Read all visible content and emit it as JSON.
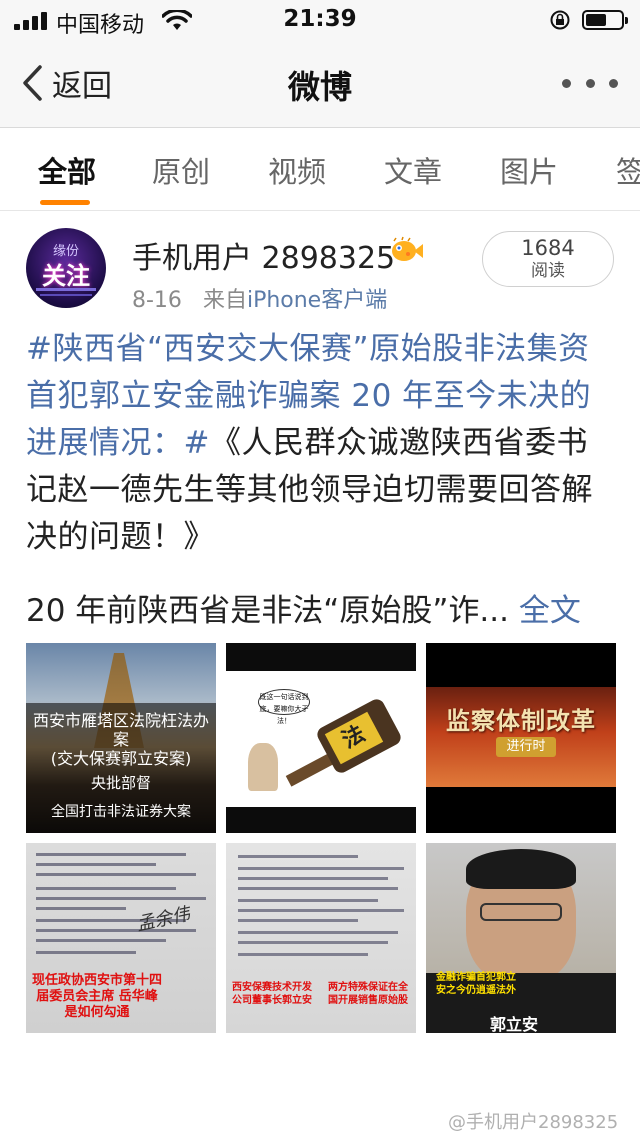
{
  "status_bar": {
    "carrier": "中国移动",
    "time": "21:39",
    "icons": [
      "signal-icon",
      "wifi-icon",
      "rotation-lock-icon",
      "battery-icon"
    ]
  },
  "nav": {
    "back_label": "返回",
    "title": "微博",
    "more_icon": "more-dots-icon"
  },
  "tabs": [
    {
      "label": "全部",
      "active": true
    },
    {
      "label": "原创",
      "active": false
    },
    {
      "label": "视频",
      "active": false
    },
    {
      "label": "文章",
      "active": false
    },
    {
      "label": "图片",
      "active": false
    },
    {
      "label": "签",
      "active": false
    }
  ],
  "accent_color": "#ff8200",
  "link_color": "#4a6ea8",
  "post": {
    "avatar_text": "关注",
    "avatar_top_text": "缘份",
    "username": "手机用户 2898325",
    "badge_icon": "pufferfish-badge-icon",
    "date": "8-16",
    "source_prefix": "来自",
    "source": "iPhone客户端",
    "reads_count": "1684",
    "reads_label": "阅读",
    "topic": "#陕西省“西安交大保赛”原始股非法集资首犯郭立安金融诈骗案 20 年至今未决的进展情况：#",
    "body_after_topic": "《人民群众诚邀陕西省委书记赵一德先生等其他领导迫切需要回答解决的问题！》",
    "excerpt": "20 年前陕西省是非法“原始股”诈...",
    "full_text_link": "全文",
    "images": {
      "img1": {
        "line1": "西安市雁塔区法院枉法办案",
        "line1b": "(交大保赛郭立安案)",
        "line2": "央批部督",
        "line3": "全国打击非法证券大案"
      },
      "img2": {
        "bubble": "既这一句话说到底，要嘛你大于法！",
        "gavel_text": "法"
      },
      "img3": {
        "title": "监察体制改革",
        "subtitle": "进行时"
      },
      "img4": {
        "signature": "孟余伟",
        "red_text": "现任政协西安市第十四届委员会主席 岳华峰是如何勾通"
      },
      "img5": {
        "red_text_left": "西安保赛技术开发公司董事长郭立安",
        "red_text_right": "两方特殊保证在全国开展销售原始股"
      },
      "img6": {
        "caption": "金融诈骗首犯郭立安之今仍逍遥法外",
        "name": "郭立安"
      }
    }
  },
  "watermark": "@手机用户2898325"
}
